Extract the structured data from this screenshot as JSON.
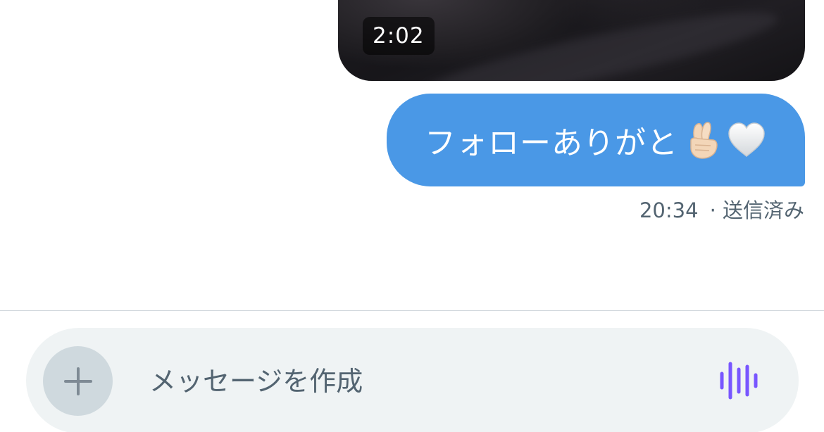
{
  "conversation": {
    "video_message": {
      "duration": "2:02"
    },
    "sent_message": {
      "text": "フォローありがと",
      "emoji": [
        "crossed-fingers",
        "white-heart"
      ]
    },
    "message_meta": {
      "time": "20:34",
      "status": "· 送信済み"
    }
  },
  "composer": {
    "placeholder": "メッセージを作成",
    "add_icon": "plus-icon",
    "voice_icon": "waveform-icon"
  },
  "colors": {
    "bubble": "#4a98e6",
    "composer_bg": "#eff3f4",
    "add_button_bg": "#cfd9de",
    "voice_accent": "#7856ff",
    "meta_text": "#536471"
  }
}
